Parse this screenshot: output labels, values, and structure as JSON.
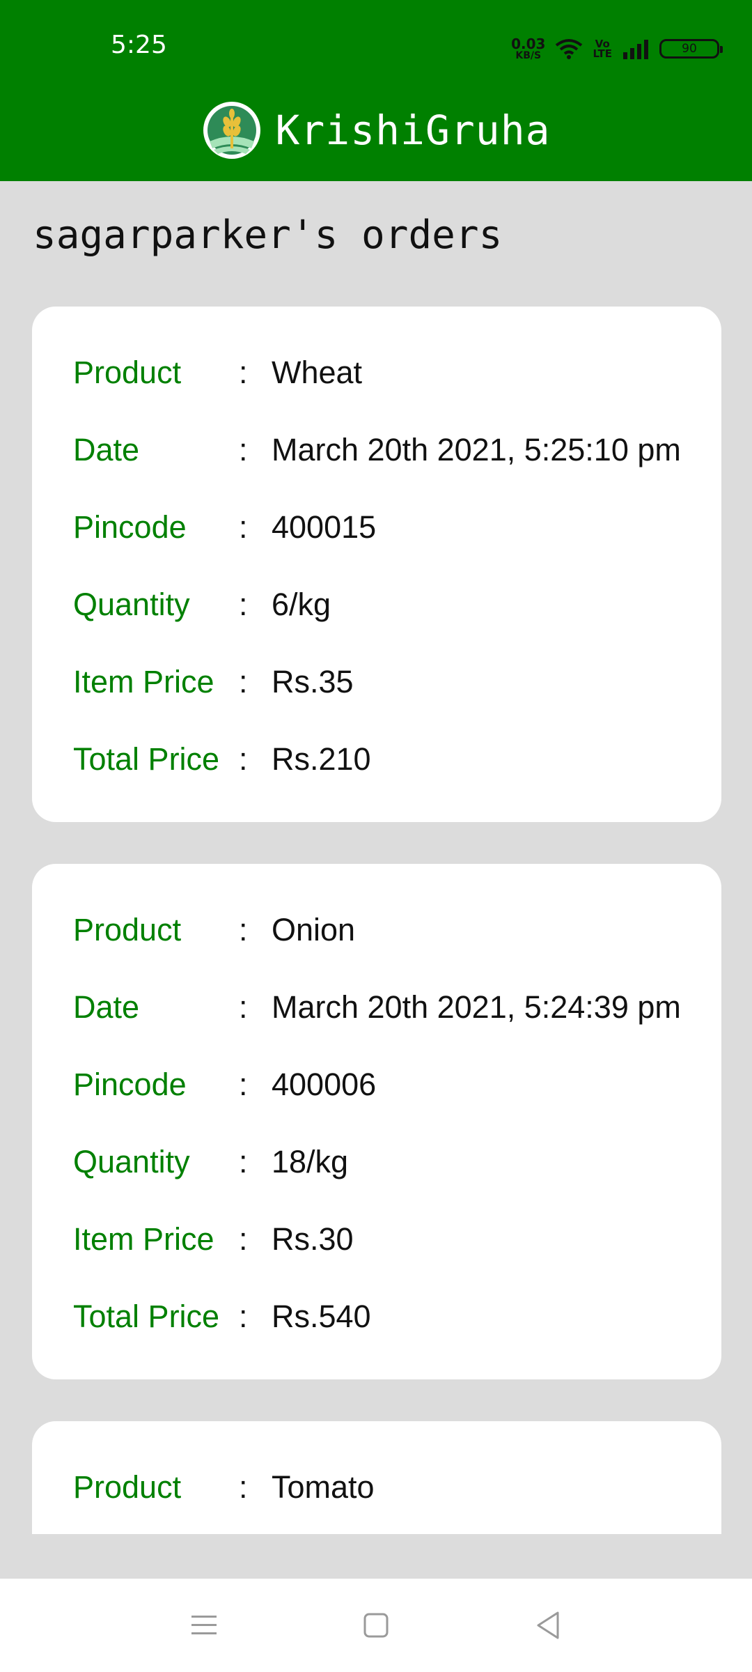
{
  "status_bar": {
    "time": "5:25",
    "net_speed_value": "0.03",
    "net_speed_unit": "KB/S",
    "volte_top": "Vo",
    "volte_bottom": "LTE",
    "battery": "90"
  },
  "app": {
    "title": "KrishiGruha",
    "logo_icon": "wheat-logo-icon"
  },
  "page": {
    "title": "sagarparker's orders"
  },
  "labels": {
    "product": "Product",
    "date": "Date",
    "pincode": "Pincode",
    "quantity": "Quantity",
    "item_price": "Item Price",
    "total_price": "Total Price",
    "separator": ":"
  },
  "orders": [
    {
      "product": "Wheat",
      "date": "March 20th 2021, 5:25:10 pm",
      "pincode": "400015",
      "quantity": "6/kg",
      "item_price": "Rs.35",
      "total_price": "Rs.210"
    },
    {
      "product": "Onion",
      "date": "March 20th 2021, 5:24:39 pm",
      "pincode": "400006",
      "quantity": "18/kg",
      "item_price": "Rs.30",
      "total_price": "Rs.540"
    },
    {
      "product": "Tomato"
    }
  ],
  "nav": {
    "icons": [
      "menu-icon",
      "home-square-icon",
      "back-triangle-icon"
    ]
  },
  "colors": {
    "brand": "#008000",
    "background": "#dcdcdc",
    "label": "#008000"
  }
}
